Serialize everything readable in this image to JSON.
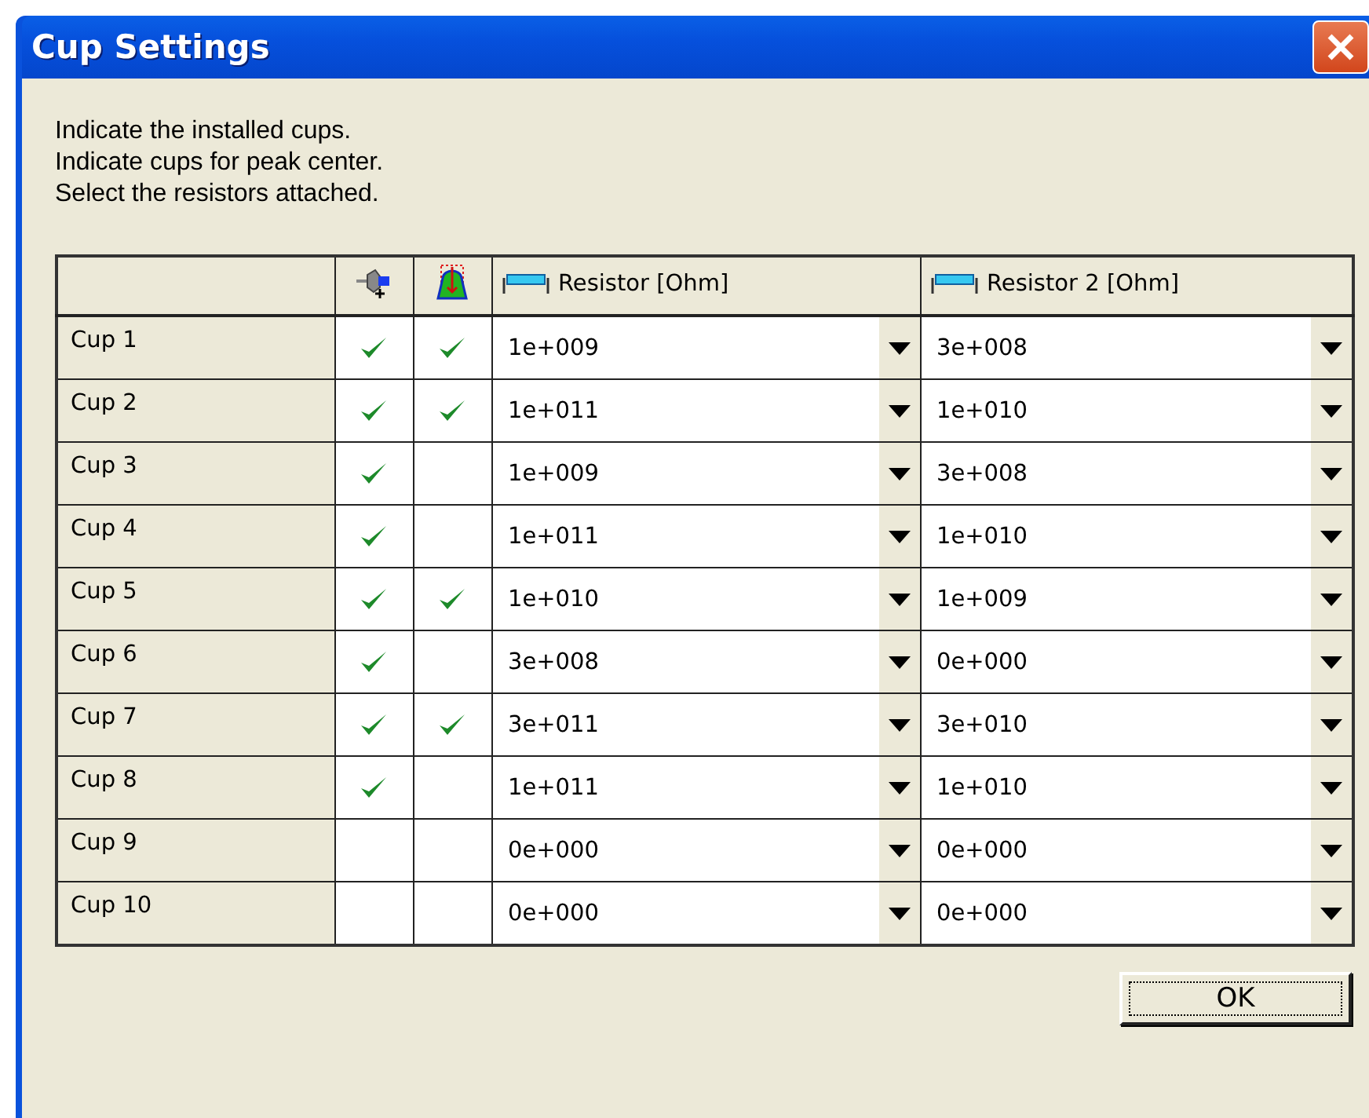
{
  "window": {
    "title": "Cup Settings"
  },
  "instructions": [
    "Indicate the installed cups.",
    "Indicate cups for peak center.",
    "Select the resistors attached."
  ],
  "table": {
    "columns": [
      "Resistor [Ohm]",
      "Resistor 2 [Ohm]"
    ],
    "rows": [
      {
        "name": "Cup 1",
        "installed": true,
        "peak_center": true,
        "resistor": "1e+009",
        "resistor_2": "3e+008"
      },
      {
        "name": "Cup 2",
        "installed": true,
        "peak_center": true,
        "resistor": "1e+011",
        "resistor_2": "1e+010"
      },
      {
        "name": "Cup 3",
        "installed": true,
        "peak_center": false,
        "resistor": "1e+009",
        "resistor_2": "3e+008"
      },
      {
        "name": "Cup 4",
        "installed": true,
        "peak_center": false,
        "resistor": "1e+011",
        "resistor_2": "1e+010"
      },
      {
        "name": "Cup 5",
        "installed": true,
        "peak_center": true,
        "resistor": "1e+010",
        "resistor_2": "1e+009"
      },
      {
        "name": "Cup 6",
        "installed": true,
        "peak_center": false,
        "resistor": "3e+008",
        "resistor_2": "0e+000"
      },
      {
        "name": "Cup 7",
        "installed": true,
        "peak_center": true,
        "resistor": "3e+011",
        "resistor_2": "3e+010"
      },
      {
        "name": "Cup 8",
        "installed": true,
        "peak_center": false,
        "resistor": "1e+011",
        "resistor_2": "1e+010"
      },
      {
        "name": "Cup 9",
        "installed": false,
        "peak_center": false,
        "resistor": "0e+000",
        "resistor_2": "0e+000"
      },
      {
        "name": "Cup 10",
        "installed": false,
        "peak_center": false,
        "resistor": "0e+000",
        "resistor_2": "0e+000"
      }
    ]
  },
  "buttons": [
    "OK"
  ]
}
